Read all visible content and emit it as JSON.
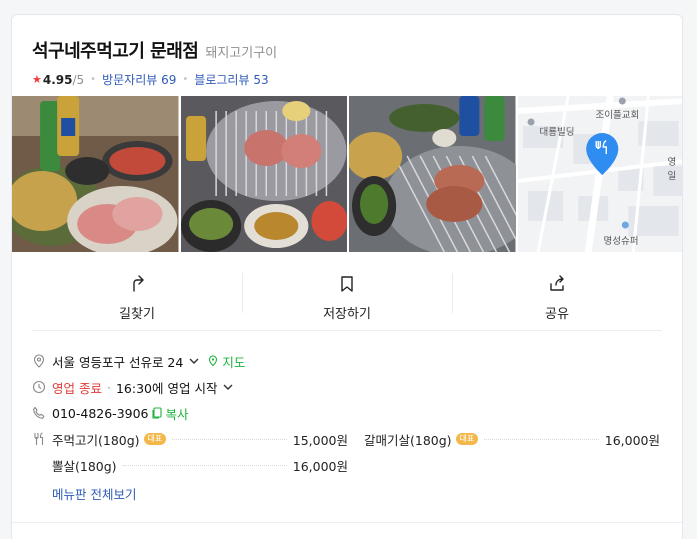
{
  "place": {
    "name": "석구네주먹고기 문래점",
    "category": "돼지고기구이",
    "rating_star": "★",
    "rating": "4.95",
    "rating_max": "/5",
    "visitor_reviews_label": "방문자리뷰",
    "visitor_reviews_count": "69",
    "blog_reviews_label": "블로그리뷰",
    "blog_reviews_count": "53"
  },
  "map": {
    "labels": [
      "조이플교회",
      "대룡빌딩",
      "영일",
      "명성슈퍼"
    ]
  },
  "actions": [
    {
      "label": "길찾기",
      "icon": "directions-icon"
    },
    {
      "label": "저장하기",
      "icon": "bookmark-icon"
    },
    {
      "label": "공유",
      "icon": "share-icon"
    }
  ],
  "info": {
    "address": "서울 영등포구 선유로 24",
    "map_link": "지도",
    "status": "영업 종료",
    "status_sep": "·",
    "next_open": "16:30에 영업 시작",
    "phone": "010-4826-3906",
    "copy_label": "복사"
  },
  "menu": {
    "items": [
      {
        "name": "주먹고기(180g)",
        "badge": "대표",
        "price": "15,000원"
      },
      {
        "name": "갈매기살(180g)",
        "badge": "대표",
        "price": "16,000원"
      },
      {
        "name": "뽈살(180g)",
        "badge": "",
        "price": "16,000원"
      }
    ],
    "more_label": "메뉴판 전체보기"
  },
  "colors": {
    "accent_green": "#1cb43e",
    "closed_red": "#e23b3b",
    "link_blue": "#2f5bb7",
    "badge_yellow": "#f2b84b",
    "pin_blue": "#2f8cf0"
  }
}
